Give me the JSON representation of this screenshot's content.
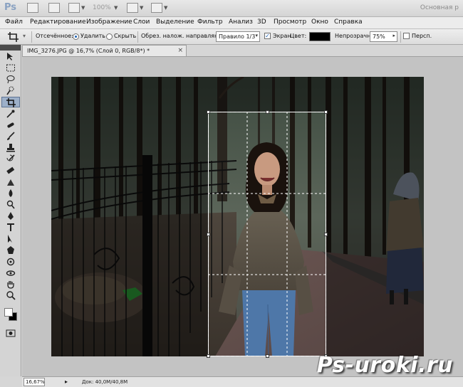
{
  "app": {
    "logo": "Ps",
    "zoom_level": "100%",
    "workspace_label": "Основная р"
  },
  "menu": {
    "items": [
      "Файл",
      "Редактирование",
      "Изображение",
      "Слои",
      "Выделение",
      "Фильтр",
      "Анализ",
      "3D",
      "Просмотр",
      "Окно",
      "Справка"
    ]
  },
  "options": {
    "cropped_label": "Отсечённое:",
    "delete_label": "Удалить",
    "hide_label": "Скрыть",
    "overlay_label": "Обрез. налож. направляющ:",
    "overlay_value": "Правило 1/3",
    "screen_label": "Экран",
    "color_label": "Цвет:",
    "opacity_label": "Непрозрачность:",
    "opacity_value": "75%",
    "perspective_label": "Персп.",
    "shield_color": "#000000"
  },
  "document": {
    "tab_title": "IMG_3276.JPG @ 16,7% (Слой 0, RGB/8*) *",
    "close_glyph": "×"
  },
  "status": {
    "zoom": "16,67%",
    "doc_size": "Док: 40,0M/40,8M"
  },
  "watermark": "Ps-uroki.ru",
  "tools": [
    "move-tool",
    "marquee-tool",
    "lasso-tool",
    "quick-select-tool",
    "crop-tool",
    "eyedropper-tool",
    "healing-brush-tool",
    "brush-tool",
    "clone-stamp-tool",
    "history-brush-tool",
    "eraser-tool",
    "gradient-tool",
    "blur-tool",
    "dodge-tool",
    "pen-tool",
    "type-tool",
    "path-select-tool",
    "shape-tool",
    "3d-rotate-tool",
    "3d-orbit-tool",
    "hand-tool",
    "zoom-tool"
  ],
  "colors": {
    "foreground": "#ffffff",
    "background": "#000000",
    "accent": "#9db0c9"
  }
}
